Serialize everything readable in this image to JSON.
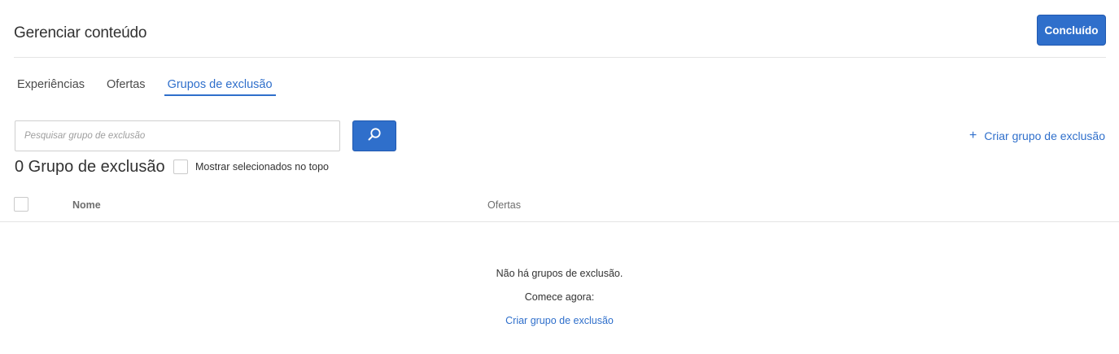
{
  "header": {
    "title": "Gerenciar conteúdo",
    "done_label": "Concluído"
  },
  "tabs": [
    {
      "label": "Experiências",
      "active": false
    },
    {
      "label": "Ofertas",
      "active": false
    },
    {
      "label": "Grupos de exclusão",
      "active": true
    }
  ],
  "search": {
    "placeholder": "Pesquisar grupo de exclusão",
    "value": "",
    "icon": "search-icon"
  },
  "create_link": {
    "icon": "plus-icon",
    "label": "Criar grupo de exclusão"
  },
  "count_label": "0 Grupo de exclusão",
  "show_selected": {
    "label": "Mostrar selecionados no topo",
    "checked": false
  },
  "table": {
    "columns": [
      "Nome",
      "Ofertas"
    ],
    "rows": []
  },
  "empty_state": {
    "message": "Não há grupos de exclusão.",
    "prompt": "Comece agora:",
    "link": "Criar grupo de exclusão"
  },
  "colors": {
    "accent": "#2f6fcb",
    "text": "#323232",
    "border": "#e4e4e4"
  }
}
